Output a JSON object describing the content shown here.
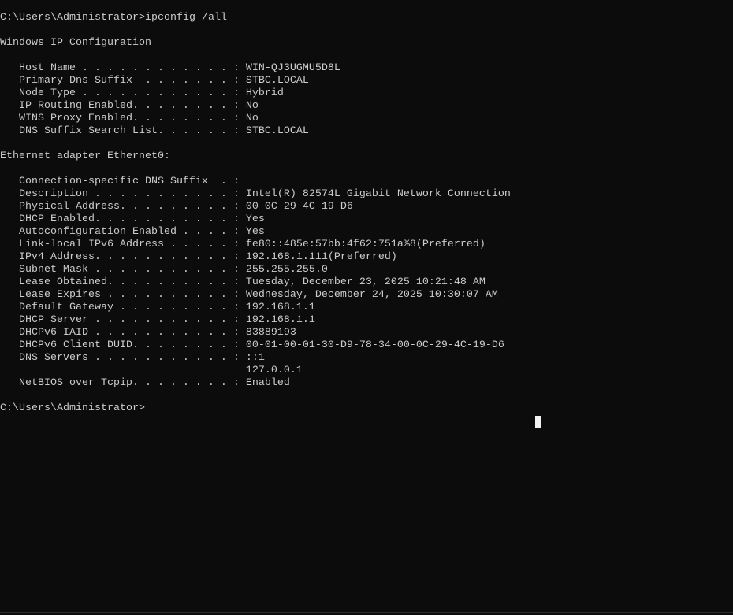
{
  "theme": {
    "background": "#0c0c0c",
    "foreground": "#cccccc",
    "cursor": "#f2f2f2"
  },
  "console": {
    "prompt": "C:\\Users\\Administrator>",
    "executed_command": "ipconfig /all"
  },
  "ip_configuration": {
    "title": "Windows IP Configuration",
    "entries": [
      {
        "label": "Host Name . . . . . . . . . . . . :",
        "value": "WIN-QJ3UGMU5D8L"
      },
      {
        "label": "Primary Dns Suffix  . . . . . . . :",
        "value": "STBC.LOCAL"
      },
      {
        "label": "Node Type . . . . . . . . . . . . :",
        "value": "Hybrid"
      },
      {
        "label": "IP Routing Enabled. . . . . . . . :",
        "value": "No"
      },
      {
        "label": "WINS Proxy Enabled. . . . . . . . :",
        "value": "No"
      },
      {
        "label": "DNS Suffix Search List. . . . . . :",
        "value": "STBC.LOCAL"
      }
    ]
  },
  "adapter": {
    "title": "Ethernet adapter Ethernet0:",
    "entries": [
      {
        "label": "Connection-specific DNS Suffix  . :"
      },
      {
        "label": "Description . . . . . . . . . . . :",
        "value": "Intel(R) 82574L Gigabit Network Connection"
      },
      {
        "label": "Physical Address. . . . . . . . . :",
        "value": "00-0C-29-4C-19-D6"
      },
      {
        "label": "DHCP Enabled. . . . . . . . . . . :",
        "value": "Yes"
      },
      {
        "label": "Autoconfiguration Enabled . . . . :",
        "value": "Yes"
      },
      {
        "label": "Link-local IPv6 Address . . . . . :",
        "value": "fe80::485e:57bb:4f62:751a%8(Preferred)"
      },
      {
        "label": "IPv4 Address. . . . . . . . . . . :",
        "value": "192.168.1.111(Preferred)"
      },
      {
        "label": "Subnet Mask . . . . . . . . . . . :",
        "value": "255.255.255.0"
      },
      {
        "label": "Lease Obtained. . . . . . . . . . :",
        "value": "Tuesday, December 23, 2025 10:21:48 AM"
      },
      {
        "label": "Lease Expires . . . . . . . . . . :",
        "value": "Wednesday, December 24, 2025 10:30:07 AM"
      },
      {
        "label": "Default Gateway . . . . . . . . . :",
        "value": "192.168.1.1"
      },
      {
        "label": "DHCP Server . . . . . . . . . . . :",
        "value": "192.168.1.1"
      },
      {
        "label": "DHCPv6 IAID . . . . . . . . . . . :",
        "value": "83889193"
      },
      {
        "label": "DHCPv6 Client DUID. . . . . . . . :",
        "value": "00-01-00-01-30-D9-78-34-00-0C-29-4C-19-D6"
      },
      {
        "label": "DNS Servers . . . . . . . . . . . :",
        "value": "::1",
        "additional_values": [
          "127.0.0.1"
        ]
      },
      {
        "label": "NetBIOS over Tcpip. . . . . . . . :",
        "value": "Enabled"
      }
    ]
  }
}
